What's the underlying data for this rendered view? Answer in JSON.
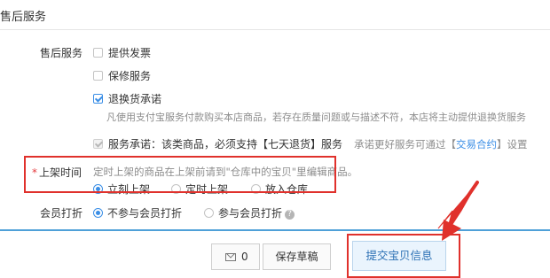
{
  "section": {
    "title": "售后服务"
  },
  "after_sales": {
    "label": "售后服务",
    "options": [
      {
        "label": "提供发票",
        "checked": false
      },
      {
        "label": "保修服务",
        "checked": false
      },
      {
        "label": "退换货承诺",
        "checked": true
      }
    ],
    "return_note": "凡使用支付宝服务付款购买本店商品，若存在质量问题或与描述不符，本店将主动提供退换货服务",
    "service_promise": {
      "label": "服务承诺：该类商品，必须支持【七天退货】服务",
      "hint_prefix": "承诺更好服务可通过【",
      "link": "交易合约",
      "hint_suffix": "】设置"
    }
  },
  "listing_time": {
    "required_mark": "*",
    "label": "上架时间",
    "note": "定时上架的商品在上架前请到\"仓库中的宝贝\"里编辑商品。",
    "options": [
      {
        "label": "立刻上架",
        "selected": true
      },
      {
        "label": "定时上架",
        "selected": false
      },
      {
        "label": "放入仓库",
        "selected": false
      }
    ]
  },
  "member_discount": {
    "label": "会员打折",
    "options": [
      {
        "label": "不参与会员打折",
        "selected": true
      },
      {
        "label": "参与会员打折",
        "selected": false
      }
    ],
    "help_icon": "?"
  },
  "footer": {
    "message_count": "0",
    "save_draft_label": "保存草稿",
    "submit_label": "提交宝贝信息"
  },
  "annotation_colors": {
    "highlight": "#e0312c",
    "accent": "#3a8ee6"
  }
}
